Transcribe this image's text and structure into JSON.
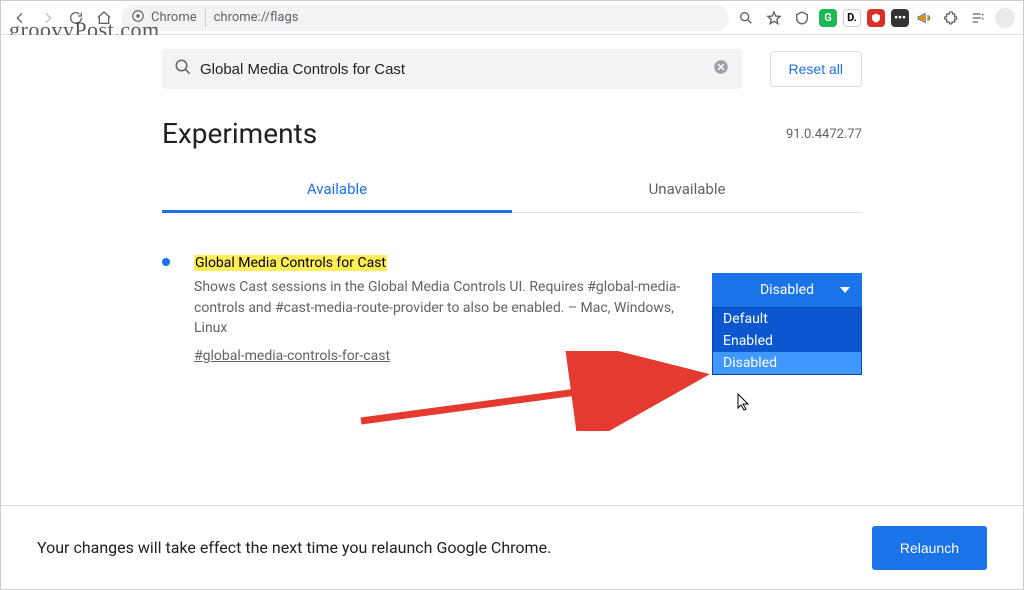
{
  "watermark": "groovyPost.com",
  "toolbar": {
    "address_app": "Chrome",
    "address_url": "chrome://flags"
  },
  "search": {
    "value": "Global Media Controls for Cast"
  },
  "reset_label": "Reset all",
  "page_title": "Experiments",
  "version": "91.0.4472.77",
  "tabs": {
    "available": "Available",
    "unavailable": "Unavailable"
  },
  "flag": {
    "title": "Global Media Controls for Cast",
    "description": "Shows Cast sessions in the Global Media Controls UI. Requires #global-media-controls and #cast-media-route-provider to also be enabled. – Mac, Windows, Linux",
    "hash": "#global-media-controls-for-cast",
    "selected": "Disabled",
    "options": [
      "Default",
      "Enabled",
      "Disabled"
    ]
  },
  "footer": {
    "message": "Your changes will take effect the next time you relaunch Google Chrome.",
    "button": "Relaunch"
  }
}
